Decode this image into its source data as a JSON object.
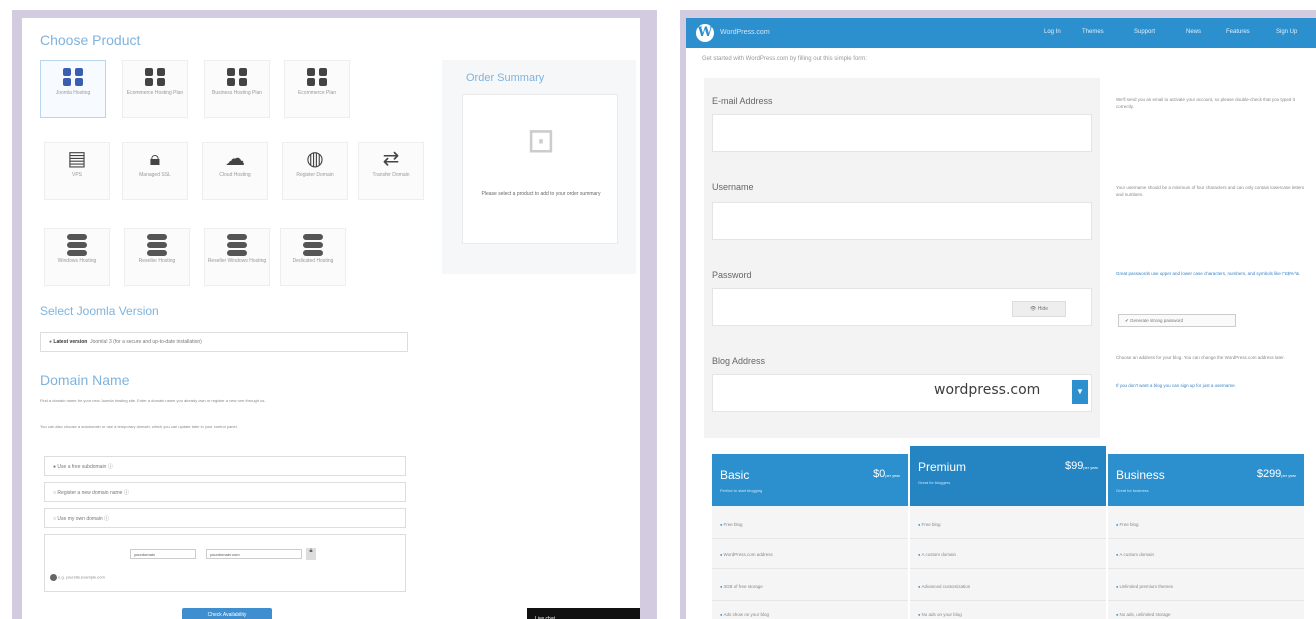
{
  "left": {
    "choose_product_title": "Choose Product",
    "products_row1": [
      "Joomla Hosting",
      "Ecommerce Hosting Plan",
      "Business Hosting Plan",
      "Ecommerce Plan"
    ],
    "products_row2": [
      "VPS",
      "Managed SSL",
      "Cloud Hosting",
      "Register Domain",
      "Transfer Domain"
    ],
    "products_row3": [
      "Windows Hosting",
      "Reseller Hosting",
      "Reseller Windows Hosting",
      "Dedicated Hosting"
    ],
    "order_summary_title": "Order Summary",
    "order_summary_text": "Please select a product to add to your order summary",
    "select_version_title": "Select Joomla Version",
    "version_field": {
      "label": "Latest version",
      "text": "Joomla! 3 (for a secure and up-to-date installation)"
    },
    "domain_title": "Domain Name",
    "domain_para1": "Find a domain name for your new Joomla hosting site. Enter a domain name you already own or register a new one through us.",
    "domain_para2": "You can also choose a subdomain or use a temporary domain, which you can update later in your control panel.",
    "domain_options": [
      "Use a free subdomain",
      "Register a new domain name",
      "Use my own domain"
    ],
    "domain_inputs": [
      "yourdomain",
      "yourdomain.com"
    ],
    "domain_note": "e.g. yoursite.example.com",
    "check_button": "Check Availability",
    "chat_tab": "Live chat"
  },
  "right": {
    "brand": "WordPress.com",
    "nav": [
      "Log In",
      "Themes",
      "Support",
      "News",
      "Features",
      "Sign Up"
    ],
    "subtitle": "Get started with WordPress.com by filling out this simple form:",
    "email_label": "E-mail Address",
    "username_label": "Username",
    "password_label": "Password",
    "blog_label": "Blog Address",
    "blog_domain": "wordpress.com",
    "blog_dropdown_icon": "chevron-down-icon",
    "password_button": "Hide",
    "email_help": "We'll send you an email to activate your account, so please double-check that you typed it correctly.",
    "username_help": "Your username should be a minimum of four characters and can only contain lowercase letters and numbers.",
    "password_help": "Great passwords use upper and lower case characters, numbers, and symbols like !\"£$%^&.",
    "password_help_button": "Generate strong password",
    "blog_help": "Choose an address for your blog. You can change the WordPress.com address later.",
    "blog_help2": "If you don't want a blog you can sign up for just a username.",
    "plans": [
      {
        "name": "Basic",
        "price": "$0",
        "unit": "per year",
        "tag": "Perfect to start blogging",
        "features": [
          "Free blog",
          "WordPress.com address",
          "3GB of free storage",
          "Ads show on your blog"
        ]
      },
      {
        "name": "Premium",
        "price": "$99",
        "unit": "per year",
        "tag": "Great for bloggers",
        "features": [
          "Free blog",
          "A custom domain",
          "Advanced customization",
          "No ads on your blog"
        ]
      },
      {
        "name": "Business",
        "price": "$299",
        "unit": "per year",
        "tag": "Great for business",
        "features": [
          "Free blog",
          "A custom domain",
          "Unlimited premium themes",
          "No ads, unlimited storage"
        ]
      }
    ]
  },
  "colors": {
    "accent_blue": "#2c8fce",
    "light_blue_title": "#7fb3dd",
    "frame_purple": "#d3cce0"
  }
}
